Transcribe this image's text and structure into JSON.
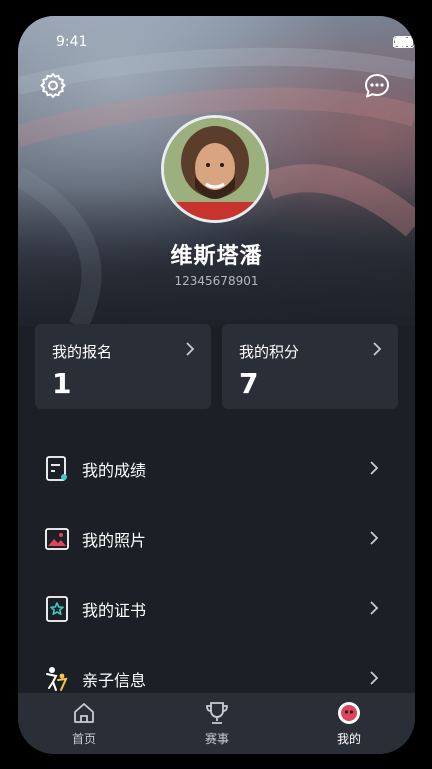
{
  "status_bar": {
    "time": "9:41"
  },
  "header": {
    "settings_icon": "gear-icon",
    "message_icon": "chat-bubble-icon"
  },
  "profile": {
    "name": "维斯塔潘",
    "phone": "12345678901"
  },
  "stats": [
    {
      "label": "我的报名",
      "value": "1"
    },
    {
      "label": "我的积分",
      "value": "7"
    }
  ],
  "menu": [
    {
      "label": "我的成绩",
      "icon": "score-report-icon"
    },
    {
      "label": "我的照片",
      "icon": "photo-icon"
    },
    {
      "label": "我的证书",
      "icon": "certificate-icon"
    },
    {
      "label": "亲子信息",
      "icon": "parent-child-icon"
    }
  ],
  "tabs": [
    {
      "label": "首页",
      "icon": "home-icon"
    },
    {
      "label": "赛事",
      "icon": "trophy-icon"
    },
    {
      "label": "我的",
      "icon": "profile-icon",
      "active": true
    }
  ],
  "colors": {
    "background": "#1c1f25",
    "card": "#2a2e36",
    "accent_red": "#e0435a",
    "icon_teal": "#3fc9c0"
  }
}
